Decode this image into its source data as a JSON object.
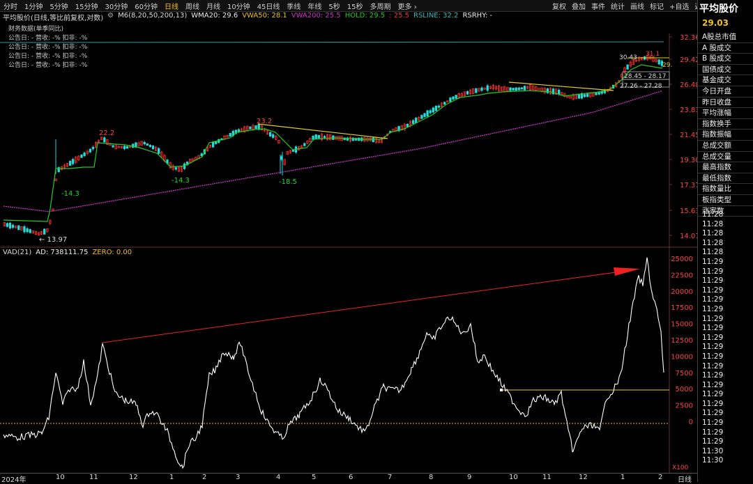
{
  "toolbar": {
    "periods": [
      "分时",
      "1分钟",
      "5分钟",
      "15分钟",
      "30分钟",
      "60分钟",
      "日线",
      "周线",
      "月线",
      "10分钟",
      "45日线",
      "季线",
      "年线",
      "5秒",
      "15秒",
      "多周期",
      "更多 ›"
    ],
    "active_index": 6,
    "right_tools": [
      "复权",
      "叠加",
      "事件",
      "统计",
      "画线",
      "标记",
      "+自选",
      "返回"
    ]
  },
  "info": {
    "name": "平均股价(日线,等比前复权,对数)",
    "m6": "M6(8,20,50,200,13)",
    "wma20": "WMA20: 29.6",
    "vwa50": "VWA50: 28.1",
    "vwa200": "VWA200: 25.5",
    "hold": "HOLD: 29.5",
    "hold2": ": 25.5",
    "rsline": "RSLINE: 32.2",
    "rsrhy": "RSRHY: -"
  },
  "finance": {
    "title": "财务数据(单季同比)",
    "rows": [
      "公告日: -   营收: -%   扣非: -%",
      "公告日: -   营收: -%   扣非: -%",
      "公告日: -   营收: -%   扣非: -%",
      "公告日: -   营收: -%   扣非: -%"
    ]
  },
  "main_axis": [
    "32.36",
    "29.42",
    "26.48",
    "23.83",
    "21.45",
    "19.30",
    "17.37",
    "15.63",
    "14.07"
  ],
  "main_labels": {
    "high1": "22.2",
    "low1": "-14.3",
    "low2": "-14.3",
    "high2": "23.2",
    "low3": "-18.5",
    "low0": "← 13.97",
    "p30": "30.43",
    "p31": "31.1",
    "p29": "29.",
    "box1": "28.45 - 28.17",
    "box2": "27.26 - 27.28"
  },
  "vad": {
    "name": "VAD(21)",
    "ad": "AD: 738111.75",
    "zero": "ZERO: 0.00",
    "axis": [
      "25000",
      "22500",
      "20000",
      "17500",
      "15000",
      "12500",
      "10000",
      "7500",
      "5000",
      "2500",
      "0"
    ],
    "unit": "X100"
  },
  "right_panel": {
    "title": "平均股价",
    "price": "29.03",
    "items": [
      "A股总市值",
      "A 股成交",
      "B 股成交",
      "国债成交",
      "基金成交",
      "今日开盘",
      "昨日收盘",
      "平均涨幅",
      "指数换手",
      "指数振幅",
      "总成交额",
      "总成交量",
      "最高指数",
      "最低指数",
      "指数量比",
      "板指类型",
      "涨家数"
    ],
    "times": [
      "11:28",
      "11:28",
      "11:28",
      "11:28",
      "11:28",
      "11:29",
      "11:29",
      "11:29",
      "11:29",
      "11:29",
      "11:29",
      "11:29",
      "11:29",
      "11:29",
      "11:29",
      "11:29",
      "11:29",
      "11:29",
      "11:29",
      "11:29",
      "11:29",
      "11:29",
      "11:29",
      "11:29",
      "11:29",
      "11:30",
      "11:30"
    ]
  },
  "dates": {
    "labels": [
      "2024年",
      "10",
      "11",
      "12",
      "1",
      "2",
      "3",
      "4",
      "5",
      "6",
      "7",
      "8",
      "9",
      "10",
      "11",
      "12",
      "1",
      "2"
    ],
    "period_label": "日线"
  },
  "colors": {
    "candle_up": "#ff3333",
    "candle_down": "#22dddd",
    "hold": "#22cc22",
    "vwa200": "#cc33cc",
    "rsline": "#33bbbb",
    "trend": "#e8d020",
    "arrow": "#ee2222"
  }
}
